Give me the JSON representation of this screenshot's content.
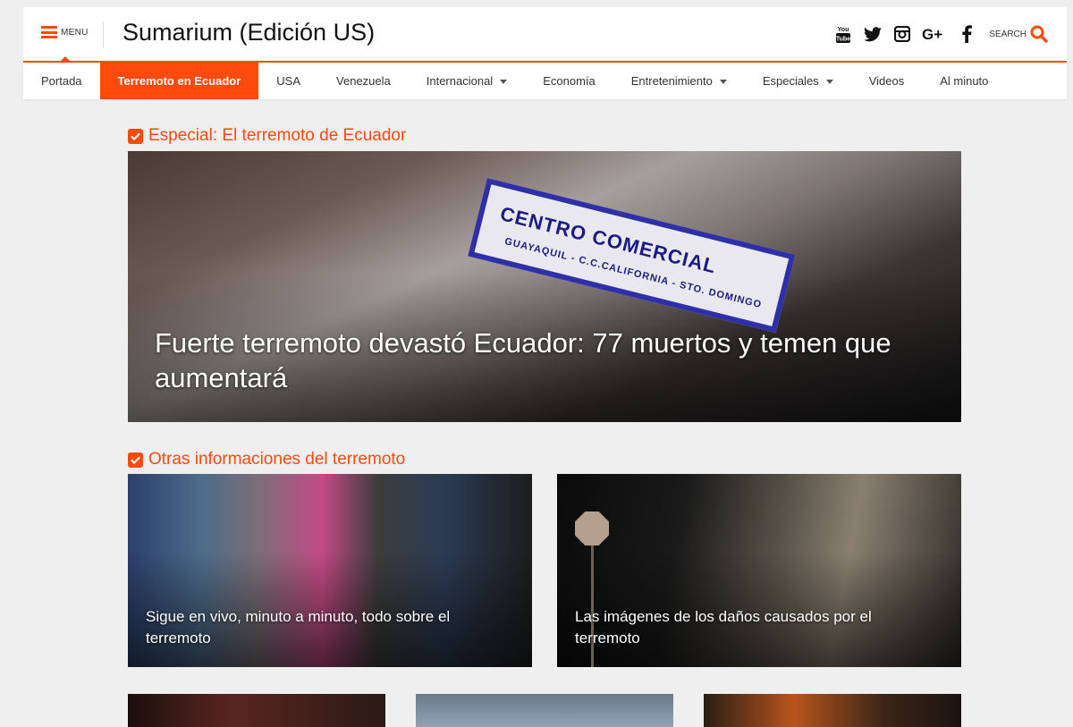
{
  "header": {
    "menu_label": "MENU",
    "site_title": "Sumarium (Edición US)",
    "search_label": "SEARCH",
    "social_icons": [
      "youtube-icon",
      "twitter-icon",
      "instagram-icon",
      "google-plus-icon",
      "facebook-icon"
    ],
    "youtube_text": "You Tube",
    "accent_color": "#ff4a0d"
  },
  "nav": {
    "items": [
      {
        "label": "Portada",
        "active": false,
        "dropdown": false
      },
      {
        "label": "Terremoto en Ecuador",
        "active": true,
        "dropdown": false
      },
      {
        "label": "USA",
        "active": false,
        "dropdown": false
      },
      {
        "label": "Venezuela",
        "active": false,
        "dropdown": false
      },
      {
        "label": "Internacional",
        "active": false,
        "dropdown": true
      },
      {
        "label": "Economía",
        "active": false,
        "dropdown": false
      },
      {
        "label": "Entretenimiento",
        "active": false,
        "dropdown": true
      },
      {
        "label": "Especiales",
        "active": false,
        "dropdown": true
      },
      {
        "label": "Videos",
        "active": false,
        "dropdown": false
      },
      {
        "label": "Al minuto",
        "active": false,
        "dropdown": false
      }
    ]
  },
  "main": {
    "special_heading": "Especial: El terremoto de Ecuador",
    "hero": {
      "headline": "Fuerte terremoto devastó Ecuador: 77 muertos y temen que aumentará",
      "sign_text": "CENTRO COMERCIAL",
      "sign_subtext": "GUAYAQUIL - C.C.CALIFORNIA - STO. DOMINGO"
    },
    "other_heading": "Otras informaciones del terremoto",
    "cards": [
      {
        "headline": "Sigue en vivo, minuto a minuto, todo sobre el terremoto"
      },
      {
        "headline": "Las imágenes de los daños causados por el terremoto"
      }
    ]
  }
}
